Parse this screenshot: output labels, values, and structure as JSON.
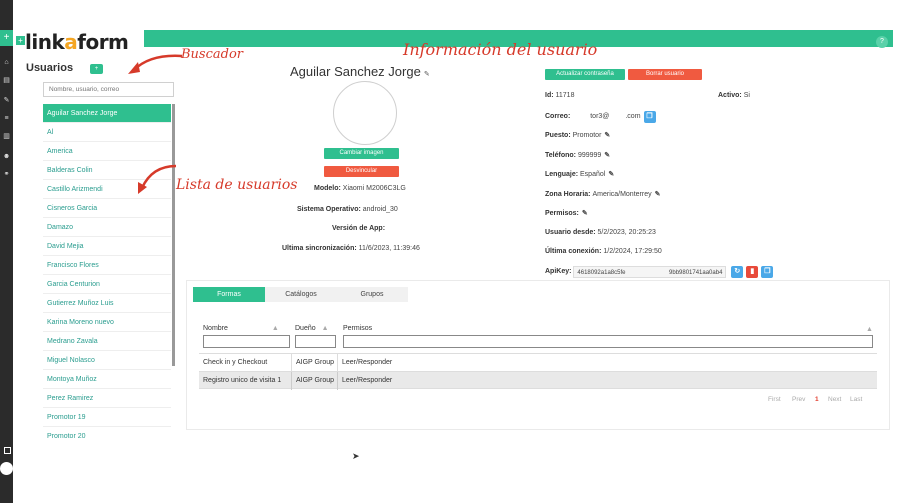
{
  "brand": {
    "prefix": "link",
    "accent": "a",
    "suffix": "form",
    "plus": "+",
    "accent_color": "#f5a623",
    "primary_color": "#2fbf8f"
  },
  "help_label": "?",
  "sidebar": {
    "title": "Usuarios",
    "add_icon": "user-plus-icon",
    "search_placeholder": "Nombre, usuario, correo",
    "users": [
      "Aguilar Sanchez Jorge",
      "Al",
      "America",
      "Balderas Colin",
      "Castillo Arizmendi",
      "Cisneros Garcia",
      "Damazo",
      "David Mejia",
      "Francisco Flores",
      "Garcia Centurion",
      "Gutierrez Muñoz Luis",
      "Karina Moreno nuevo",
      "Medrano Zavala",
      "Miguel Nolasco",
      "Montoya Muñoz",
      "Perez Ramirez",
      "Promotor 19",
      "Promotor 20"
    ]
  },
  "annotations": {
    "buscador": "Buscador",
    "informacion": "Información del usuario",
    "lista": "Lista de usuarios"
  },
  "profile": {
    "name": "Aguilar Sanchez Jorge",
    "change_image_label": "Cambiar imagen",
    "unlink_label": "Desvincular",
    "model_label": "Modelo:",
    "model_value": "Xiaomi M2006C3LG",
    "os_label": "Sistema Operativo:",
    "os_value": "android_30",
    "app_version_label": "Versión de App:",
    "app_version_value": "",
    "last_sync_label": "Ultima sincronización:",
    "last_sync_value": "11/6/2023, 11:39:46"
  },
  "details": {
    "update_password_label": "Actualizar contraseña",
    "delete_user_label": "Borrar usuario",
    "id_label": "Id:",
    "id_value": "11718",
    "active_label": "Activo:",
    "active_value": "Si",
    "email_label": "Correo:",
    "email_value": "tor3@",
    "email_domain": ".com",
    "position_label": "Puesto:",
    "position_value": "Promotor",
    "phone_label": "Teléfono:",
    "phone_value": "999999",
    "language_label": "Lenguaje:",
    "language_value": "Español",
    "timezone_label": "Zona Horaria:",
    "timezone_value": "America/Monterrey",
    "permissions_label": "Permisos:",
    "user_since_label": "Usuario desde:",
    "user_since_value": "5/2/2023, 20:25:23",
    "last_connection_label": "Última conexión:",
    "last_connection_value": "1/2/2024, 17:29:50",
    "apikey_label": "ApiKey:",
    "apikey_value": "4618092a1a8c5fe",
    "apikey_value_end": "9bb9801741aa0ab4"
  },
  "tabs": [
    "Formas",
    "Catálogos",
    "Grupos"
  ],
  "table": {
    "headers": [
      "Nombre",
      "Dueño",
      "Permisos"
    ],
    "rows": [
      [
        "Check in y Checkout",
        "AIGP Group",
        "Leer/Responder"
      ],
      [
        "Registro unico de visita 1",
        "AIGP Group",
        "Leer/Responder"
      ]
    ]
  },
  "pager": {
    "first": "First",
    "prev": "Prev",
    "current": "1",
    "next": "Next",
    "last": "Last"
  }
}
